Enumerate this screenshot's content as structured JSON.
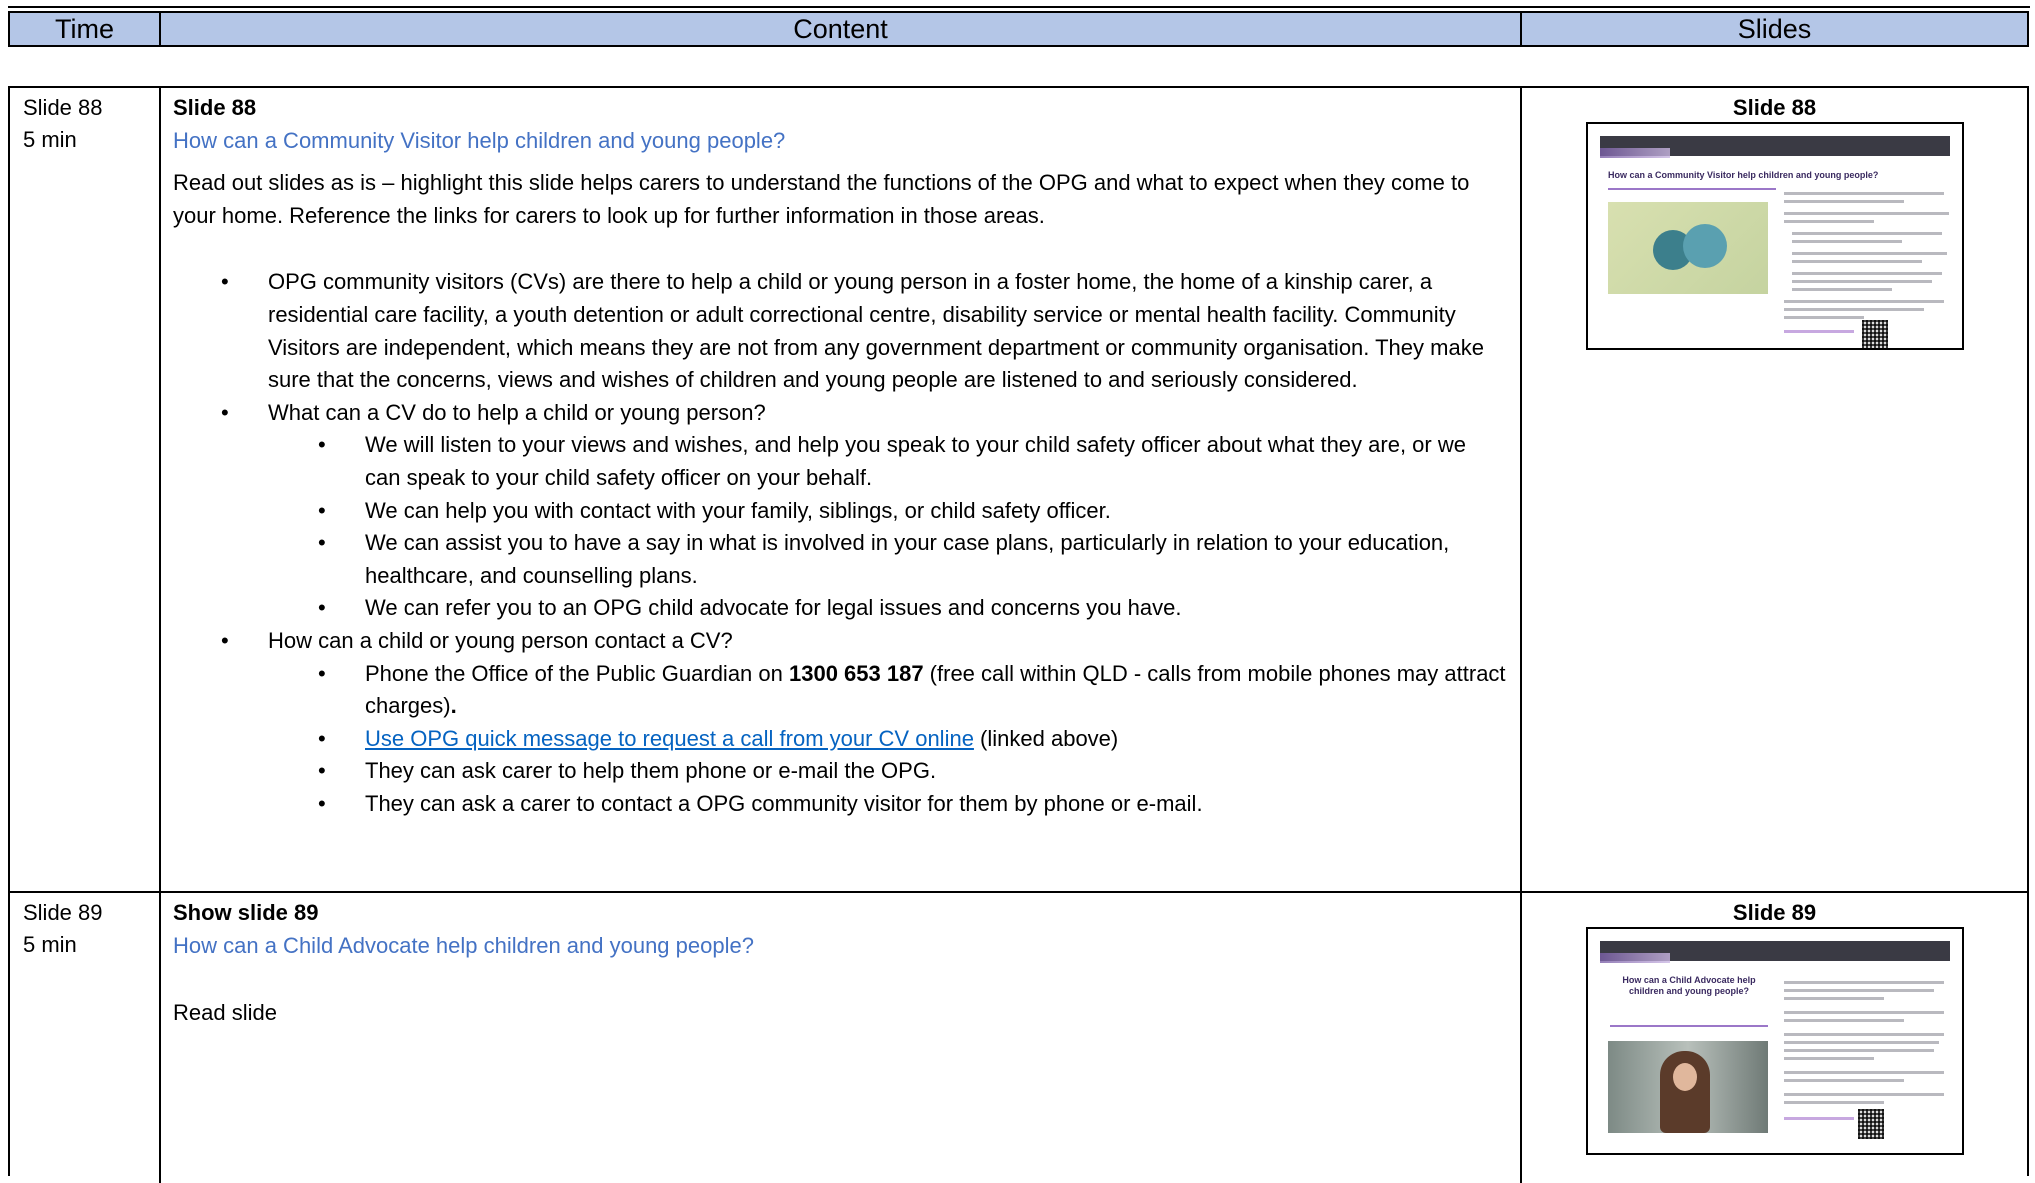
{
  "header": {
    "time": "Time",
    "content": "Content",
    "slides": "Slides"
  },
  "rows": [
    {
      "time": "Slide 88",
      "duration": "5 min",
      "heading": "Slide 88",
      "subtitle": "How can a Community Visitor help children and young people?",
      "intro": "Read out slides as is – highlight this slide helps carers to understand the functions of the OPG and what to expect when they come to your home.  Reference the links for carers to look up for further information in those areas.",
      "bullets": {
        "b1": "OPG community visitors (CVs) are there to help a child or young person in a foster home, the home of a kinship carer, a residential care facility, a youth detention or adult correctional centre, disability service or mental health facility. Community Visitors are independent, which means they are not from any government department or community organisation. They make sure that the concerns, views and wishes of children and young people are listened to and seriously considered.",
        "b2": "What can a CV do to help a child or young person?",
        "b2_sub": [
          "We will listen to your views and wishes, and help you speak to your child safety officer about what they are, or we can speak to your child safety officer on your behalf.",
          "We can help you with contact with your family, siblings, or child safety officer.",
          "We can assist you to have a say in what is involved in your case plans, particularly in relation to your education, healthcare, and counselling plans.",
          "We can refer you to an OPG child advocate for legal issues and concerns you have."
        ],
        "b3": "How can a child or young person contact a CV?",
        "b3_phone_pre": "Phone the Office of the Public Guardian on ",
        "b3_phone_num": "1300 653 187",
        "b3_phone_post": " (free call within QLD - calls from mobile phones may attract charges)",
        "b3_phone_end": ".",
        "b3_link": "Use OPG quick message to request a call from your CV online",
        "b3_link_post": " (linked above)",
        "b3_sub3": "They can ask carer to help them phone or e-mail the OPG.",
        "b3_sub4": "They can ask a carer to contact a OPG community visitor for them by phone or e-mail."
      },
      "slide_label": "Slide 88",
      "thumb_title": "How can a Community Visitor help children and young people?"
    },
    {
      "time": "Slide 89",
      "duration": "5 min",
      "heading": "Show slide 89",
      "subtitle": "How can a Child Advocate help children and young people?",
      "intro": "Read slide",
      "slide_label": "Slide 89",
      "thumb_title": "How can a Child Advocate help children and young people?"
    }
  ],
  "bullet_glyph": "•",
  "colors": {
    "header_bg": "#b4c6e7",
    "subtitle": "#4472c4",
    "link": "#0563c1"
  }
}
